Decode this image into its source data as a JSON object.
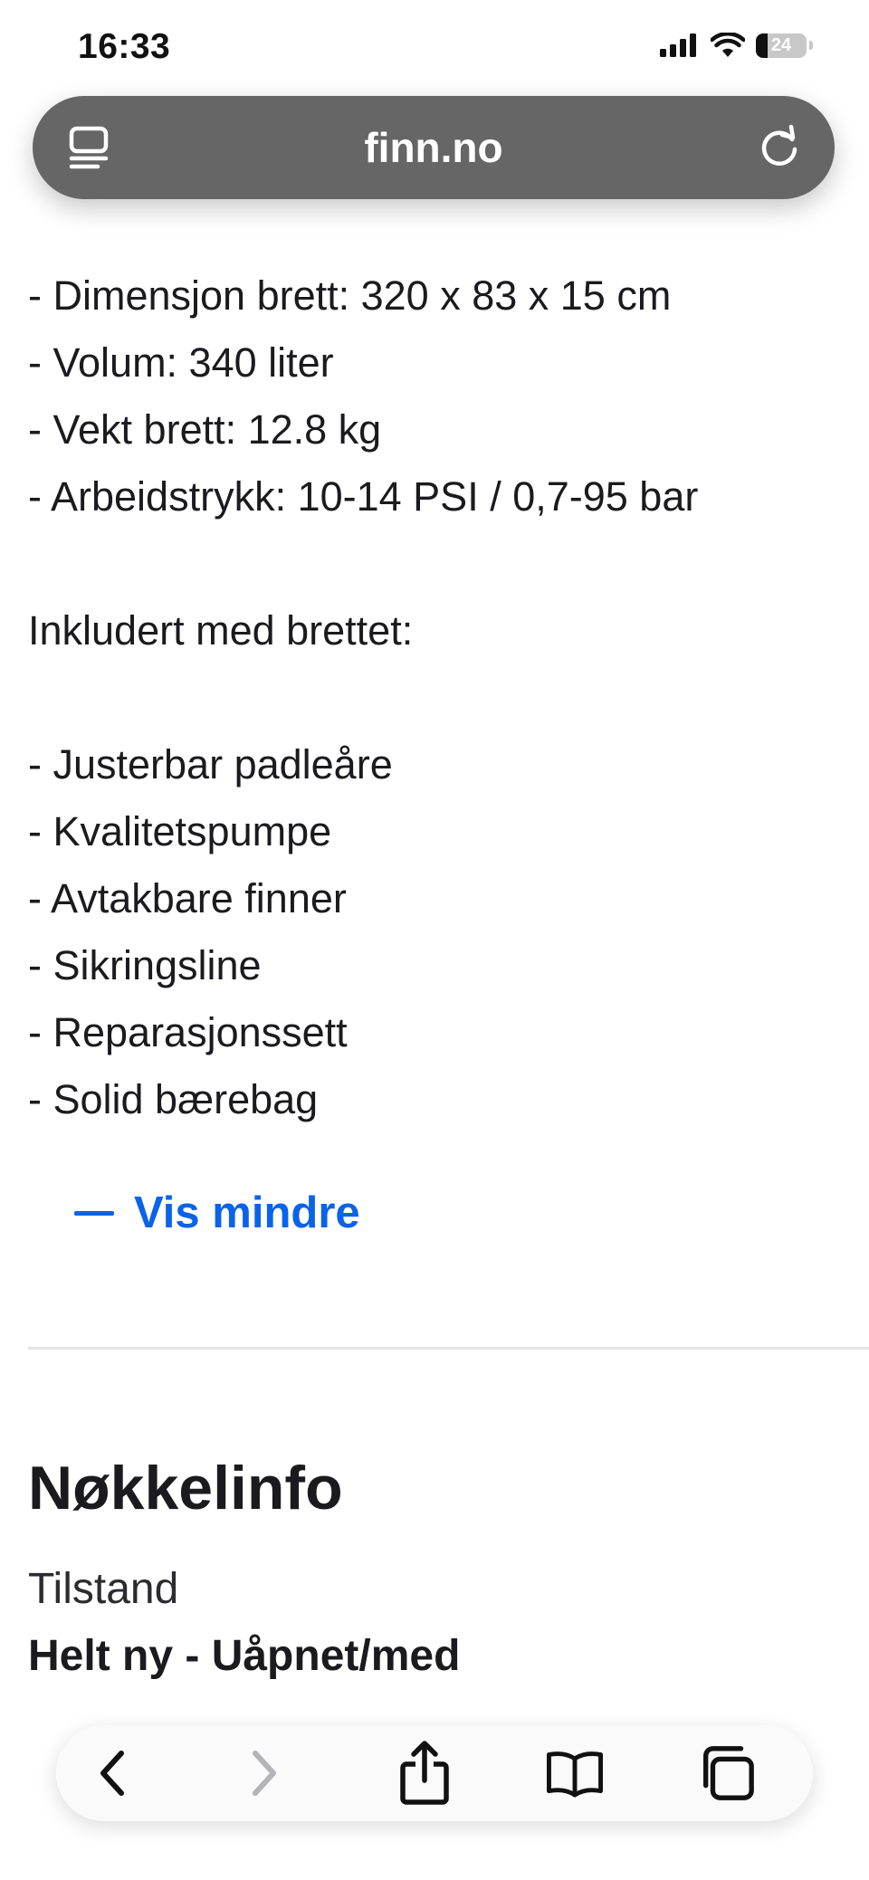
{
  "status_bar": {
    "time": "16:33",
    "battery_level": "24",
    "battery_fraction": 0.24,
    "icons": [
      "cellular-signal-icon",
      "wifi-icon",
      "battery-icon"
    ]
  },
  "address_bar": {
    "host": "finn.no",
    "left_icon": "reader-mode-icon",
    "right_icon": "reload-icon",
    "background_color": "#666666"
  },
  "description": {
    "lines": [
      "- Dimensjon brett: 320 x 83 x 15 cm",
      "- Volum: 340 liter",
      "- Vekt brett: 12.8 kg",
      "- Arbeidstrykk: 10-14 PSI / 0,7-95 bar",
      "",
      "Inkludert med brettet:",
      "",
      "- Justerbar padleåre",
      "- Kvalitetspumpe",
      "- Avtakbare finner",
      "- Sikringsline",
      "- Reparasjonssett",
      "- Solid bærebag"
    ],
    "toggle_label": "Vis mindre",
    "toggle_color": "#0a63e9"
  },
  "key_info": {
    "heading": "Nøkkelinfo",
    "items": [
      {
        "label": "Tilstand",
        "value": "Helt ny - Uåpnet/med"
      }
    ]
  },
  "toolbar": {
    "buttons": [
      {
        "icon": "back-icon",
        "enabled": true
      },
      {
        "icon": "forward-icon",
        "enabled": false
      },
      {
        "icon": "share-icon",
        "enabled": true
      },
      {
        "icon": "bookmarks-icon",
        "enabled": true
      },
      {
        "icon": "tabs-icon",
        "enabled": true
      }
    ]
  }
}
